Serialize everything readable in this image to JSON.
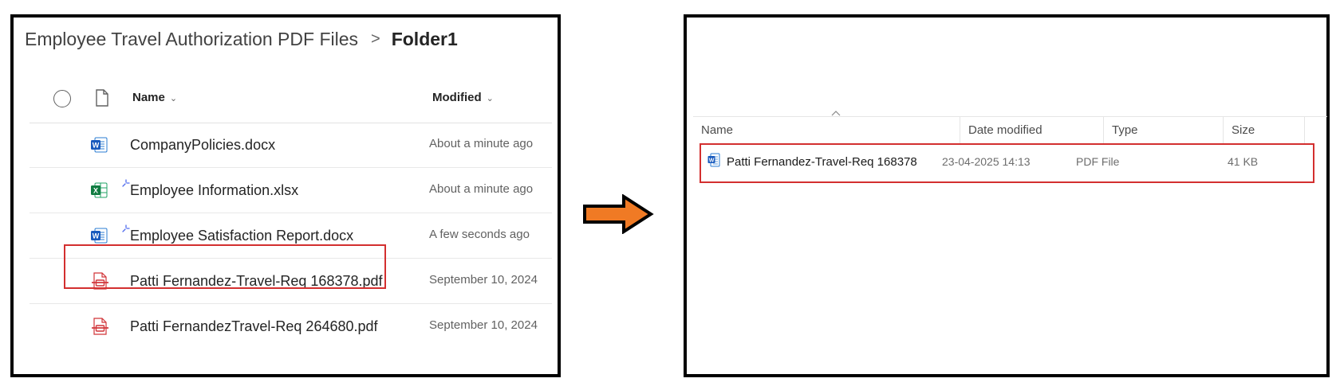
{
  "sharepoint": {
    "breadcrumb": {
      "library": "Employee Travel Authorization PDF Files",
      "separator": ">",
      "current": "Folder1"
    },
    "columns": {
      "name": "Name",
      "modified": "Modified"
    },
    "files": [
      {
        "name": "CompanyPolicies.docx",
        "modified": "About a minute ago",
        "icon": "word-icon",
        "new": false
      },
      {
        "name": "Employee Information.xlsx",
        "modified": "About a minute ago",
        "icon": "excel-icon",
        "new": true
      },
      {
        "name": "Employee Satisfaction Report.docx",
        "modified": "A few seconds ago",
        "icon": "word-icon",
        "new": true
      },
      {
        "name": "Patti Fernandez-Travel-Req 168378.pdf",
        "modified": "September 10, 2024",
        "icon": "pdf-icon",
        "new": false
      },
      {
        "name": "Patti FernandezTravel-Req 264680.pdf",
        "modified": "September 10, 2024",
        "icon": "pdf-icon",
        "new": false
      }
    ],
    "highlighted_index": 3
  },
  "explorer": {
    "columns": {
      "name": "Name",
      "date": "Date modified",
      "type": "Type",
      "size": "Size"
    },
    "files": [
      {
        "name": "Patti Fernandez-Travel-Req 168378",
        "date": "23-04-2025 14:13",
        "type": "PDF File",
        "size": "41 KB",
        "icon": "word-icon"
      }
    ]
  },
  "colors": {
    "highlight": "#d32f2f",
    "arrow": "#f07a24",
    "word": "#185abd",
    "excel": "#107c41",
    "pdf": "#d13438",
    "new_indicator": "#4f6bed"
  }
}
